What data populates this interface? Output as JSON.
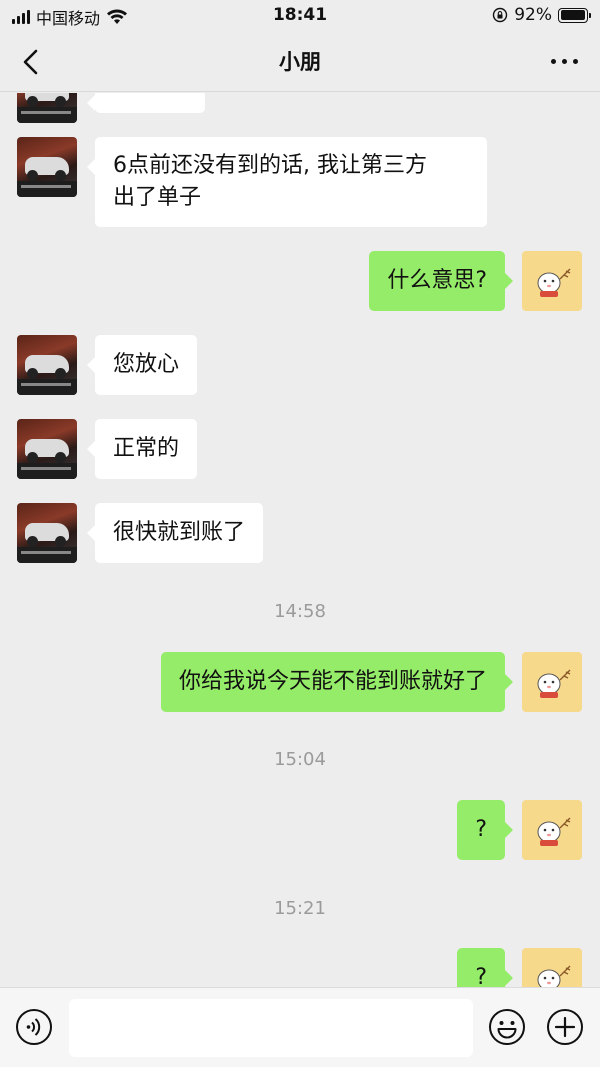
{
  "status_bar": {
    "carrier": "中国移动",
    "time": "18:41",
    "battery": "92%",
    "battery_level": 0.92
  },
  "nav": {
    "title": "小朋"
  },
  "messages": [
    {
      "side": "left",
      "text": "6点前还没有到的话, 我让第三方",
      "text2": "出了单子"
    },
    {
      "side": "right",
      "text": "什么意思?"
    },
    {
      "side": "left",
      "text": "您放心"
    },
    {
      "side": "left",
      "text": "正常的"
    },
    {
      "side": "left",
      "text": "很快就到账了"
    },
    {
      "side": "right",
      "text": "你给我说今天能不能到账就好了"
    },
    {
      "side": "right",
      "text": "?"
    },
    {
      "side": "right",
      "text": "?"
    }
  ],
  "timestamps": [
    "14:58",
    "15:04",
    "15:21"
  ],
  "input_bar": {
    "placeholder": ""
  },
  "colors": {
    "background": "#ededed",
    "sent_bubble": "#95ec69",
    "received_bubble": "#ffffff",
    "timestamp": "#9b9b9b"
  },
  "icons": [
    "back-chevron-icon",
    "more-dots-icon",
    "voice-icon",
    "emoji-icon",
    "plus-icon",
    "wifi-icon",
    "signal-icon",
    "rotation-lock-icon",
    "battery-icon"
  ]
}
